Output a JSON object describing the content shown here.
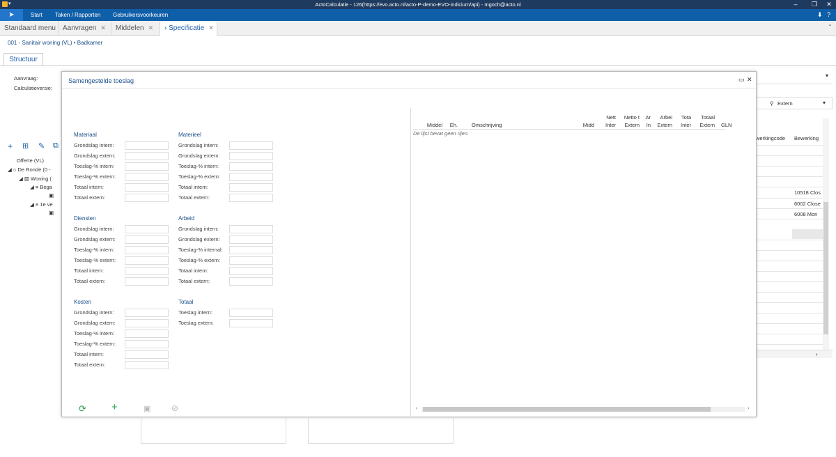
{
  "window": {
    "title": "ActoCalculatie - 126(https://evo.acto.nl/acto-P-demo-EVO-indicium/api) - mgoch@acto.nl"
  },
  "menu": {
    "items": [
      "Start",
      "Taken / Rapporten",
      "Gebruikersvoorkeuren"
    ]
  },
  "tabs": [
    {
      "label": "Standaard menu"
    },
    {
      "label": "Aanvragen"
    },
    {
      "label": "Middelen"
    },
    {
      "label": "› Specificatie"
    }
  ],
  "breadcrumb": "001 - Sanitair woning (VL) • Badkamer",
  "structuur_tab": "Structuur",
  "background": {
    "aanvraag_label": "Aanvraag:",
    "calculatieversie_label": "Calculatieversie:",
    "extern_dropdown": "Extern",
    "col_bewerkingscode": "werkingcode",
    "col_bewerking": "Bewerking",
    "tree": [
      "Offerte (VL)",
      "De Ronde (0 -",
      "Woning (",
      "Bega",
      "1e ve"
    ],
    "right_cells": [
      "10518 Clos",
      "6002 Close",
      "6008 Mon"
    ]
  },
  "dialog": {
    "title": "Samengestelde toeslag",
    "sections": {
      "materiaal": {
        "title": "Materiaal",
        "labels": [
          "Grondslag intern:",
          "Grondslag extern:",
          "Toeslag-% intern:",
          "Toeslag-% extern:",
          "Totaal intern:",
          "Totaal extern:"
        ]
      },
      "materieel": {
        "title": "Materieel",
        "labels": [
          "Grondslag intern:",
          "Grondslag extern:",
          "Toeslag-% intern:",
          "Toeslag-% extern:",
          "Totaal intern:",
          "Totaal extern:"
        ]
      },
      "diensten": {
        "title": "Diensten",
        "labels": [
          "Grondslag intern:",
          "Grondslag extern:",
          "Toeslag-% intern:",
          "Toeslag-% extern:",
          "Totaal intern:",
          "Totaal extern:"
        ]
      },
      "arbeid": {
        "title": "Arbeid",
        "labels": [
          "Grondslag intern:",
          "Grondslag extern:",
          "Toeslag-% internal:",
          "Toeslag-% extern:",
          "Totaal intern:",
          "Totaal extern:"
        ]
      },
      "kosten": {
        "title": "Kosten",
        "labels": [
          "Grondslag intern:",
          "Grondslag extern:",
          "Toeslag-% intern:",
          "Toeslag-% extern:",
          "Totaal intern:",
          "Totaal extern:"
        ]
      },
      "totaal": {
        "title": "Totaal",
        "labels": [
          "Toeslag intern:",
          "Toeslag extern:"
        ]
      }
    },
    "grid": {
      "columns": [
        {
          "l1": "",
          "l2": "Middel"
        },
        {
          "l1": "",
          "l2": "Eh."
        },
        {
          "l1": "",
          "l2": "Omschrijving"
        },
        {
          "l1": "",
          "l2": "Midd"
        },
        {
          "l1": "Nett",
          "l2": "Inter"
        },
        {
          "l1": "Netto t",
          "l2": "Extern"
        },
        {
          "l1": "Ar",
          "l2": "In"
        },
        {
          "l1": "Arbei",
          "l2": "Extern"
        },
        {
          "l1": "Tota",
          "l2": "Inter"
        },
        {
          "l1": "Totaal",
          "l2": "Extern"
        },
        {
          "l1": "",
          "l2": "GLN"
        }
      ],
      "empty_text": "De lijst bevat geen rijen."
    }
  }
}
